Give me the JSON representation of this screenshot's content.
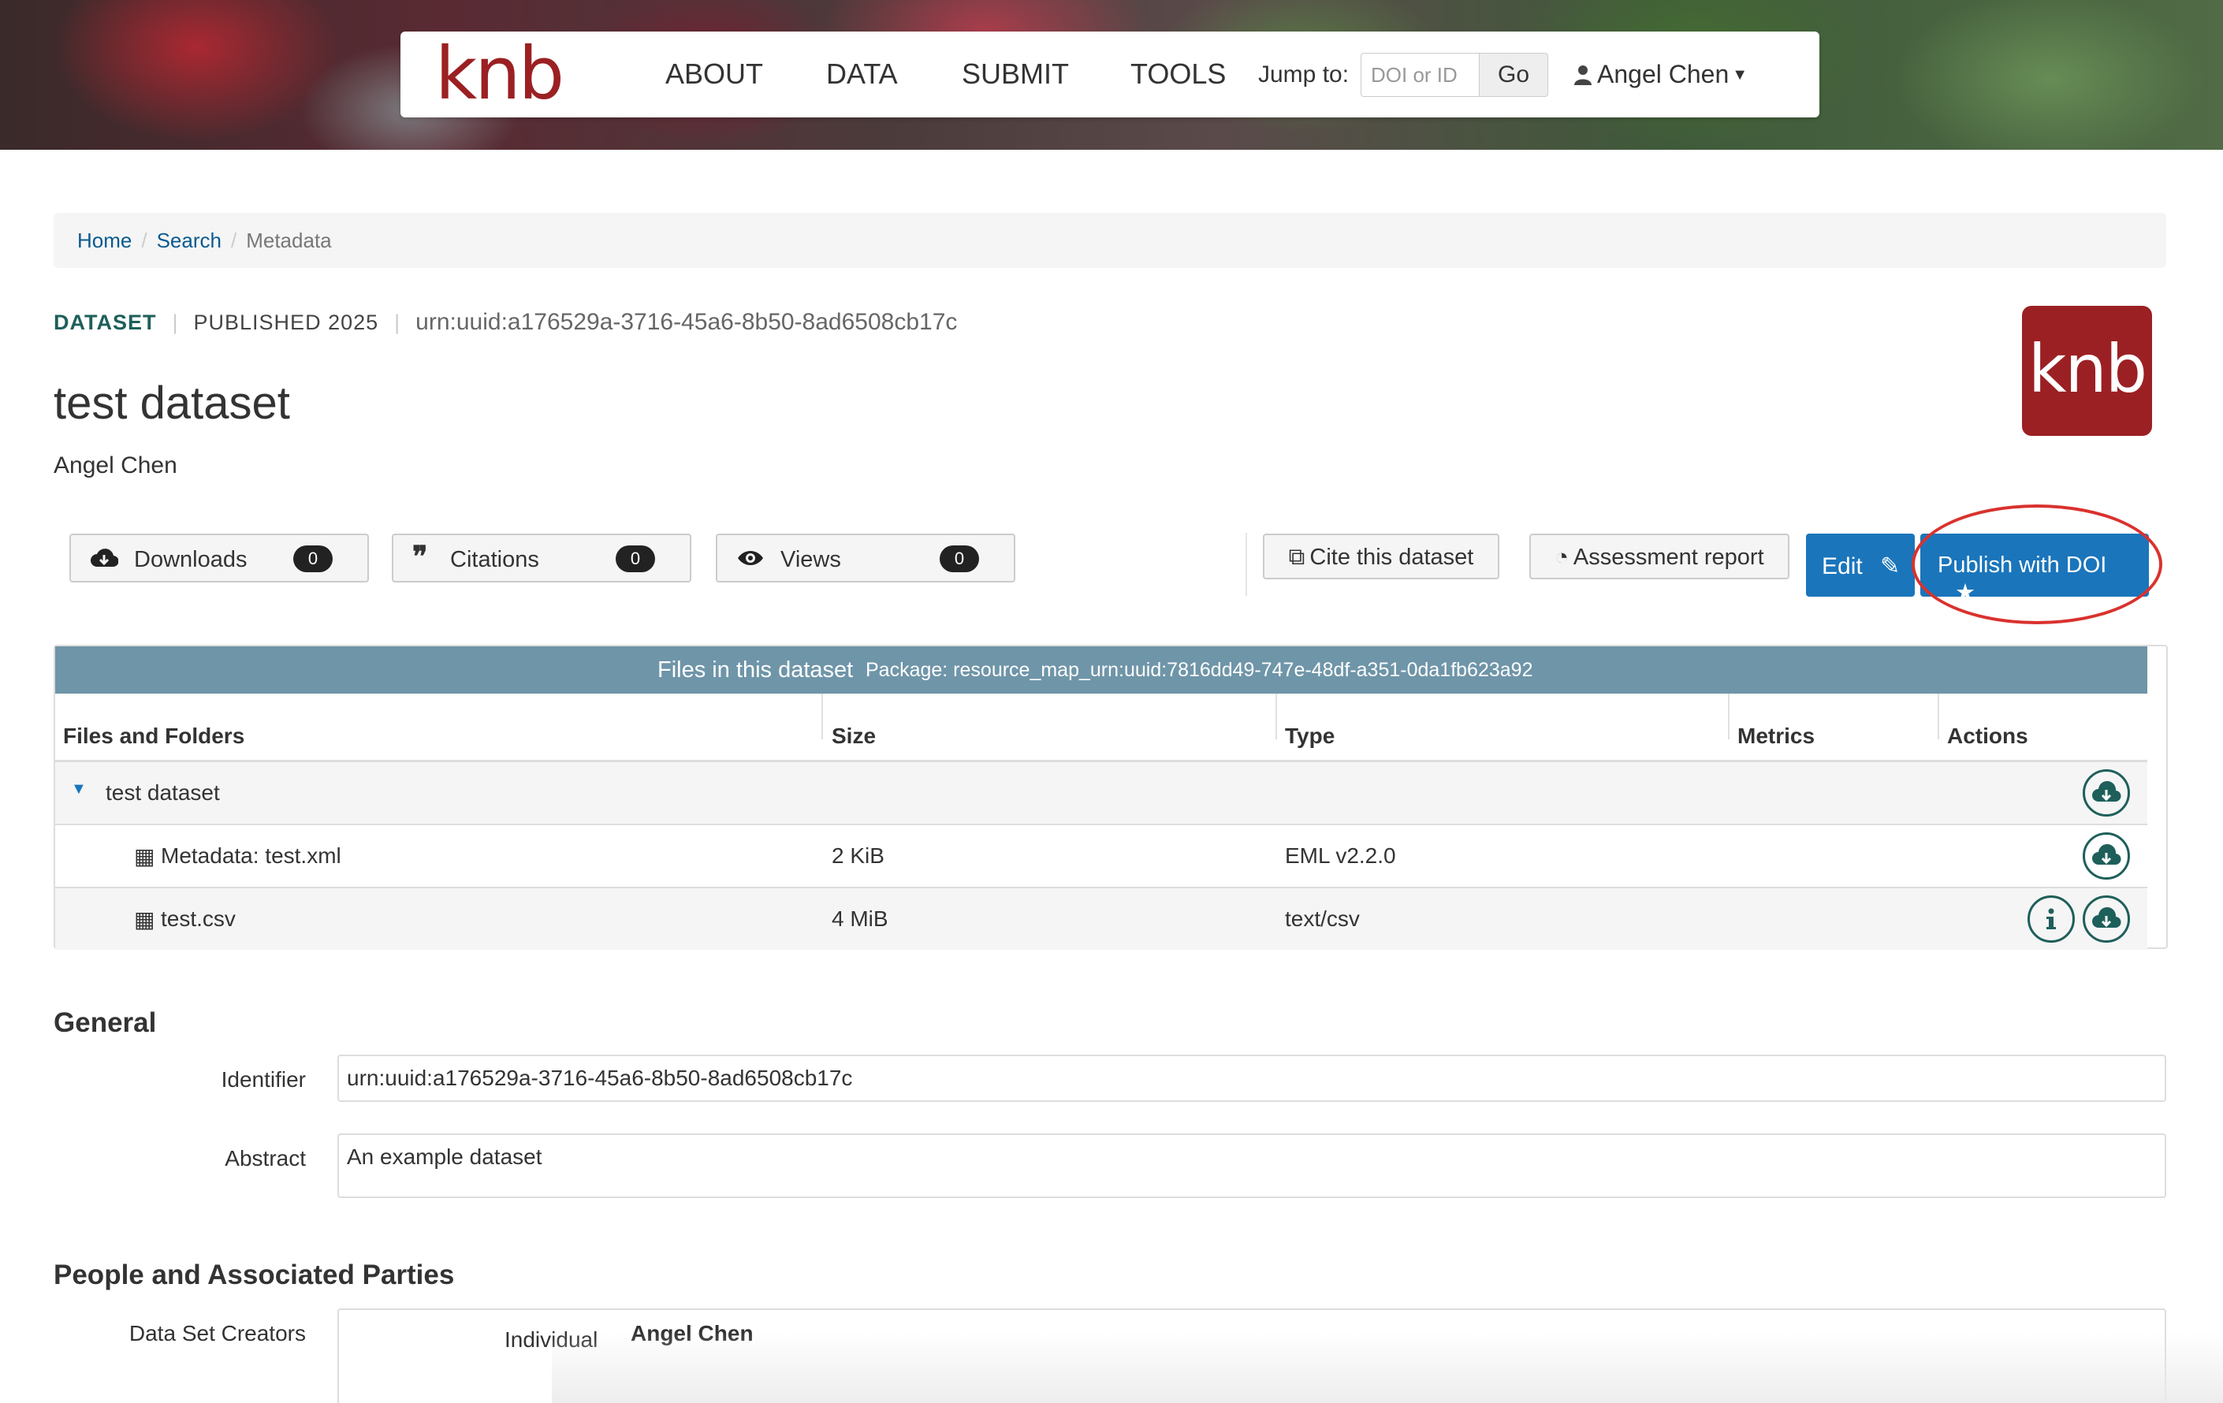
{
  "header": {
    "logo_text": "knb",
    "nav": [
      "ABOUT",
      "DATA",
      "SUBMIT",
      "TOOLS"
    ],
    "jump_label": "Jump to:",
    "jump_placeholder": "DOI or ID",
    "go_label": "Go",
    "user_name": "Angel Chen"
  },
  "breadcrumb": {
    "home": "Home",
    "search": "Search",
    "current": "Metadata"
  },
  "dataset": {
    "type_label": "DATASET",
    "published": "PUBLISHED 2025",
    "id": "urn:uuid:a176529a-3716-45a6-8b50-8ad6508cb17c",
    "title": "test dataset",
    "author": "Angel Chen",
    "logo_text": "knb"
  },
  "metrics": {
    "downloads_label": "Downloads",
    "downloads_count": "0",
    "citations_label": "Citations",
    "citations_count": "0",
    "views_label": "Views",
    "views_count": "0"
  },
  "actions": {
    "cite_label": "Cite this dataset",
    "assessment_label": "Assessment report",
    "edit_label": "Edit",
    "publish_label": "Publish with DOI"
  },
  "files": {
    "header_title": "Files in this dataset",
    "package_label": "Package: resource_map_urn:uuid:7816dd49-747e-48df-a351-0da1fb623a92",
    "columns": [
      "Files and Folders",
      "Size",
      "Type",
      "Metrics",
      "Actions"
    ],
    "folder_name": "test dataset",
    "rows": [
      {
        "name": "Metadata: test.xml",
        "size": "2 KiB",
        "type": "EML v2.2.0"
      },
      {
        "name": "test.csv",
        "size": "4 MiB",
        "type": "text/csv"
      }
    ]
  },
  "general": {
    "title": "General",
    "identifier_label": "Identifier",
    "identifier_value": "urn:uuid:a176529a-3716-45a6-8b50-8ad6508cb17c",
    "abstract_label": "Abstract",
    "abstract_value": "An example dataset"
  },
  "people": {
    "title": "People and Associated Parties",
    "creators_label": "Data Set Creators",
    "individual_label": "Individual",
    "individual_name": "Angel Chen"
  },
  "colors": {
    "brand": "#9b2023",
    "primary": "#1a75bb",
    "table_header": "#6f95a8",
    "accent_teal": "#1e5f5a",
    "highlight": "#d9322e"
  }
}
